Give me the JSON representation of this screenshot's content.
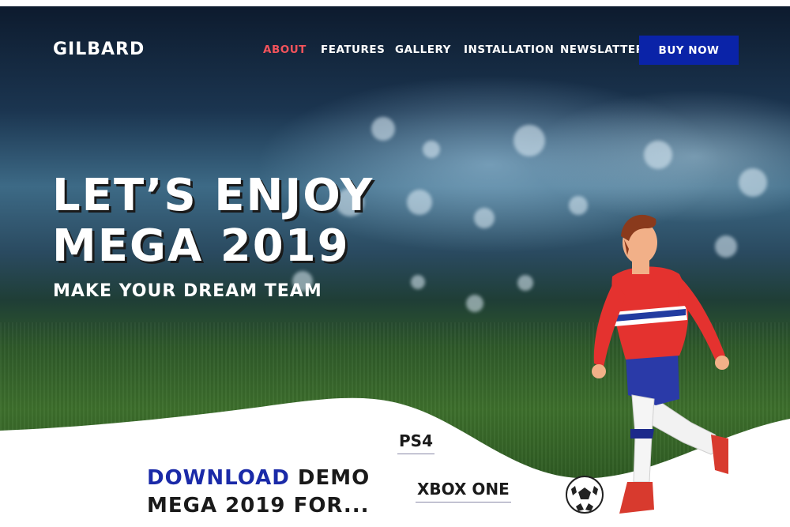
{
  "brand": {
    "logo": "GILBARD"
  },
  "nav": {
    "items": [
      {
        "label": "ABOUT",
        "active": true
      },
      {
        "label": "FEATURES",
        "active": false
      },
      {
        "label": "GALLERY",
        "active": false
      },
      {
        "label": "INSTALLATION",
        "active": false
      },
      {
        "label": "NEWSLATTER",
        "active": false
      }
    ],
    "buy_label": "BUY NOW"
  },
  "hero": {
    "headline_line1": "LET’S ENJOY",
    "headline_line2": "MEGA 2019",
    "tagline": "MAKE YOUR DREAM TEAM"
  },
  "download": {
    "highlight": "DOWNLOAD",
    "line1_rest": " DEMO",
    "line2": "MEGA 2019 FOR..."
  },
  "platforms": [
    "PS4",
    "XBOX ONE"
  ],
  "colors": {
    "accent_red": "#f2535b",
    "button_blue": "#0a23a8",
    "download_blue": "#1a2aa8"
  }
}
